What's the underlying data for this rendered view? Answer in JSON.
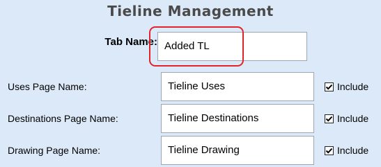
{
  "title": "Tieline Management",
  "tab_name": {
    "label": "Tab Name:",
    "value": "Added TL"
  },
  "rows": [
    {
      "label": "Uses Page Name:",
      "value": "Tieline Uses",
      "include_label": "Include",
      "include_checked": true
    },
    {
      "label": "Destinations Page Name:",
      "value": "Tieline Destinations",
      "include_label": "Include",
      "include_checked": true
    },
    {
      "label": "Drawing Page Name:",
      "value": "Tieline Drawing",
      "include_label": "Include",
      "include_checked": true
    }
  ],
  "colors": {
    "panel_background": "#dce9f8",
    "highlight": "#e0242b"
  }
}
